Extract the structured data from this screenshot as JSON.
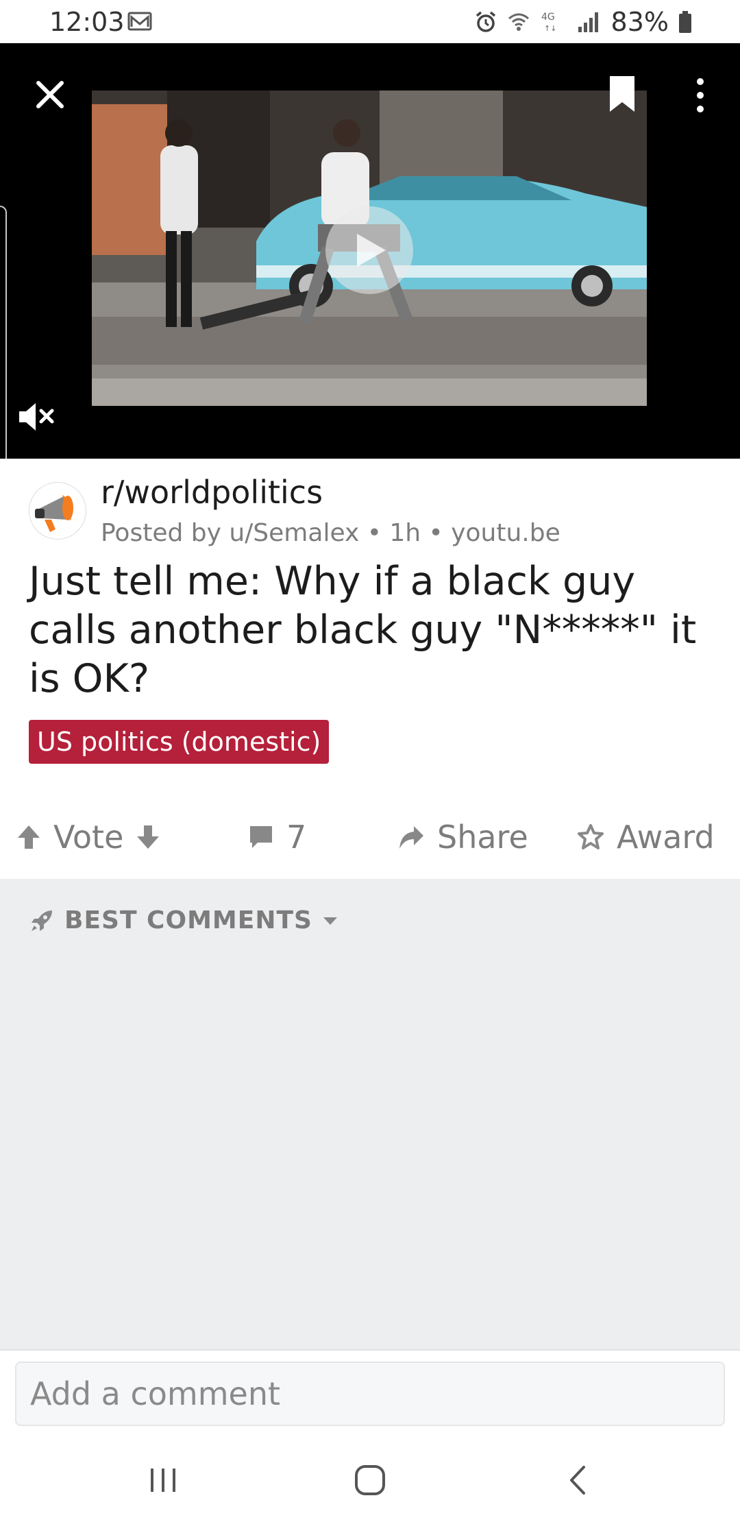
{
  "status_bar": {
    "time": "12:03",
    "battery": "83%",
    "icons": [
      "mail-icon",
      "alarm-icon",
      "wifi-icon",
      "4g-lte-icon",
      "signal-icon",
      "battery-icon"
    ]
  },
  "video": {
    "controls": [
      "close-icon",
      "bookmark-icon",
      "more-vertical-icon",
      "mute-icon",
      "play-icon"
    ]
  },
  "post": {
    "subreddit": "r/worldpolitics",
    "meta": "Posted by u/Semalex • 1h • youtu.be",
    "title": "Just tell me: Why if a black guy calls another black guy \"N*****\" it is OK?",
    "flair": "US politics (domestic)",
    "flair_color": "#b5203a"
  },
  "actions": {
    "vote_label": "Vote",
    "comments_count": "7",
    "share_label": "Share",
    "award_label": "Award"
  },
  "comments": {
    "sort_label": "BEST COMMENTS"
  },
  "comment_input": {
    "placeholder": "Add a comment"
  },
  "nav": {
    "buttons": [
      "recents-icon",
      "home-icon",
      "back-icon"
    ]
  }
}
